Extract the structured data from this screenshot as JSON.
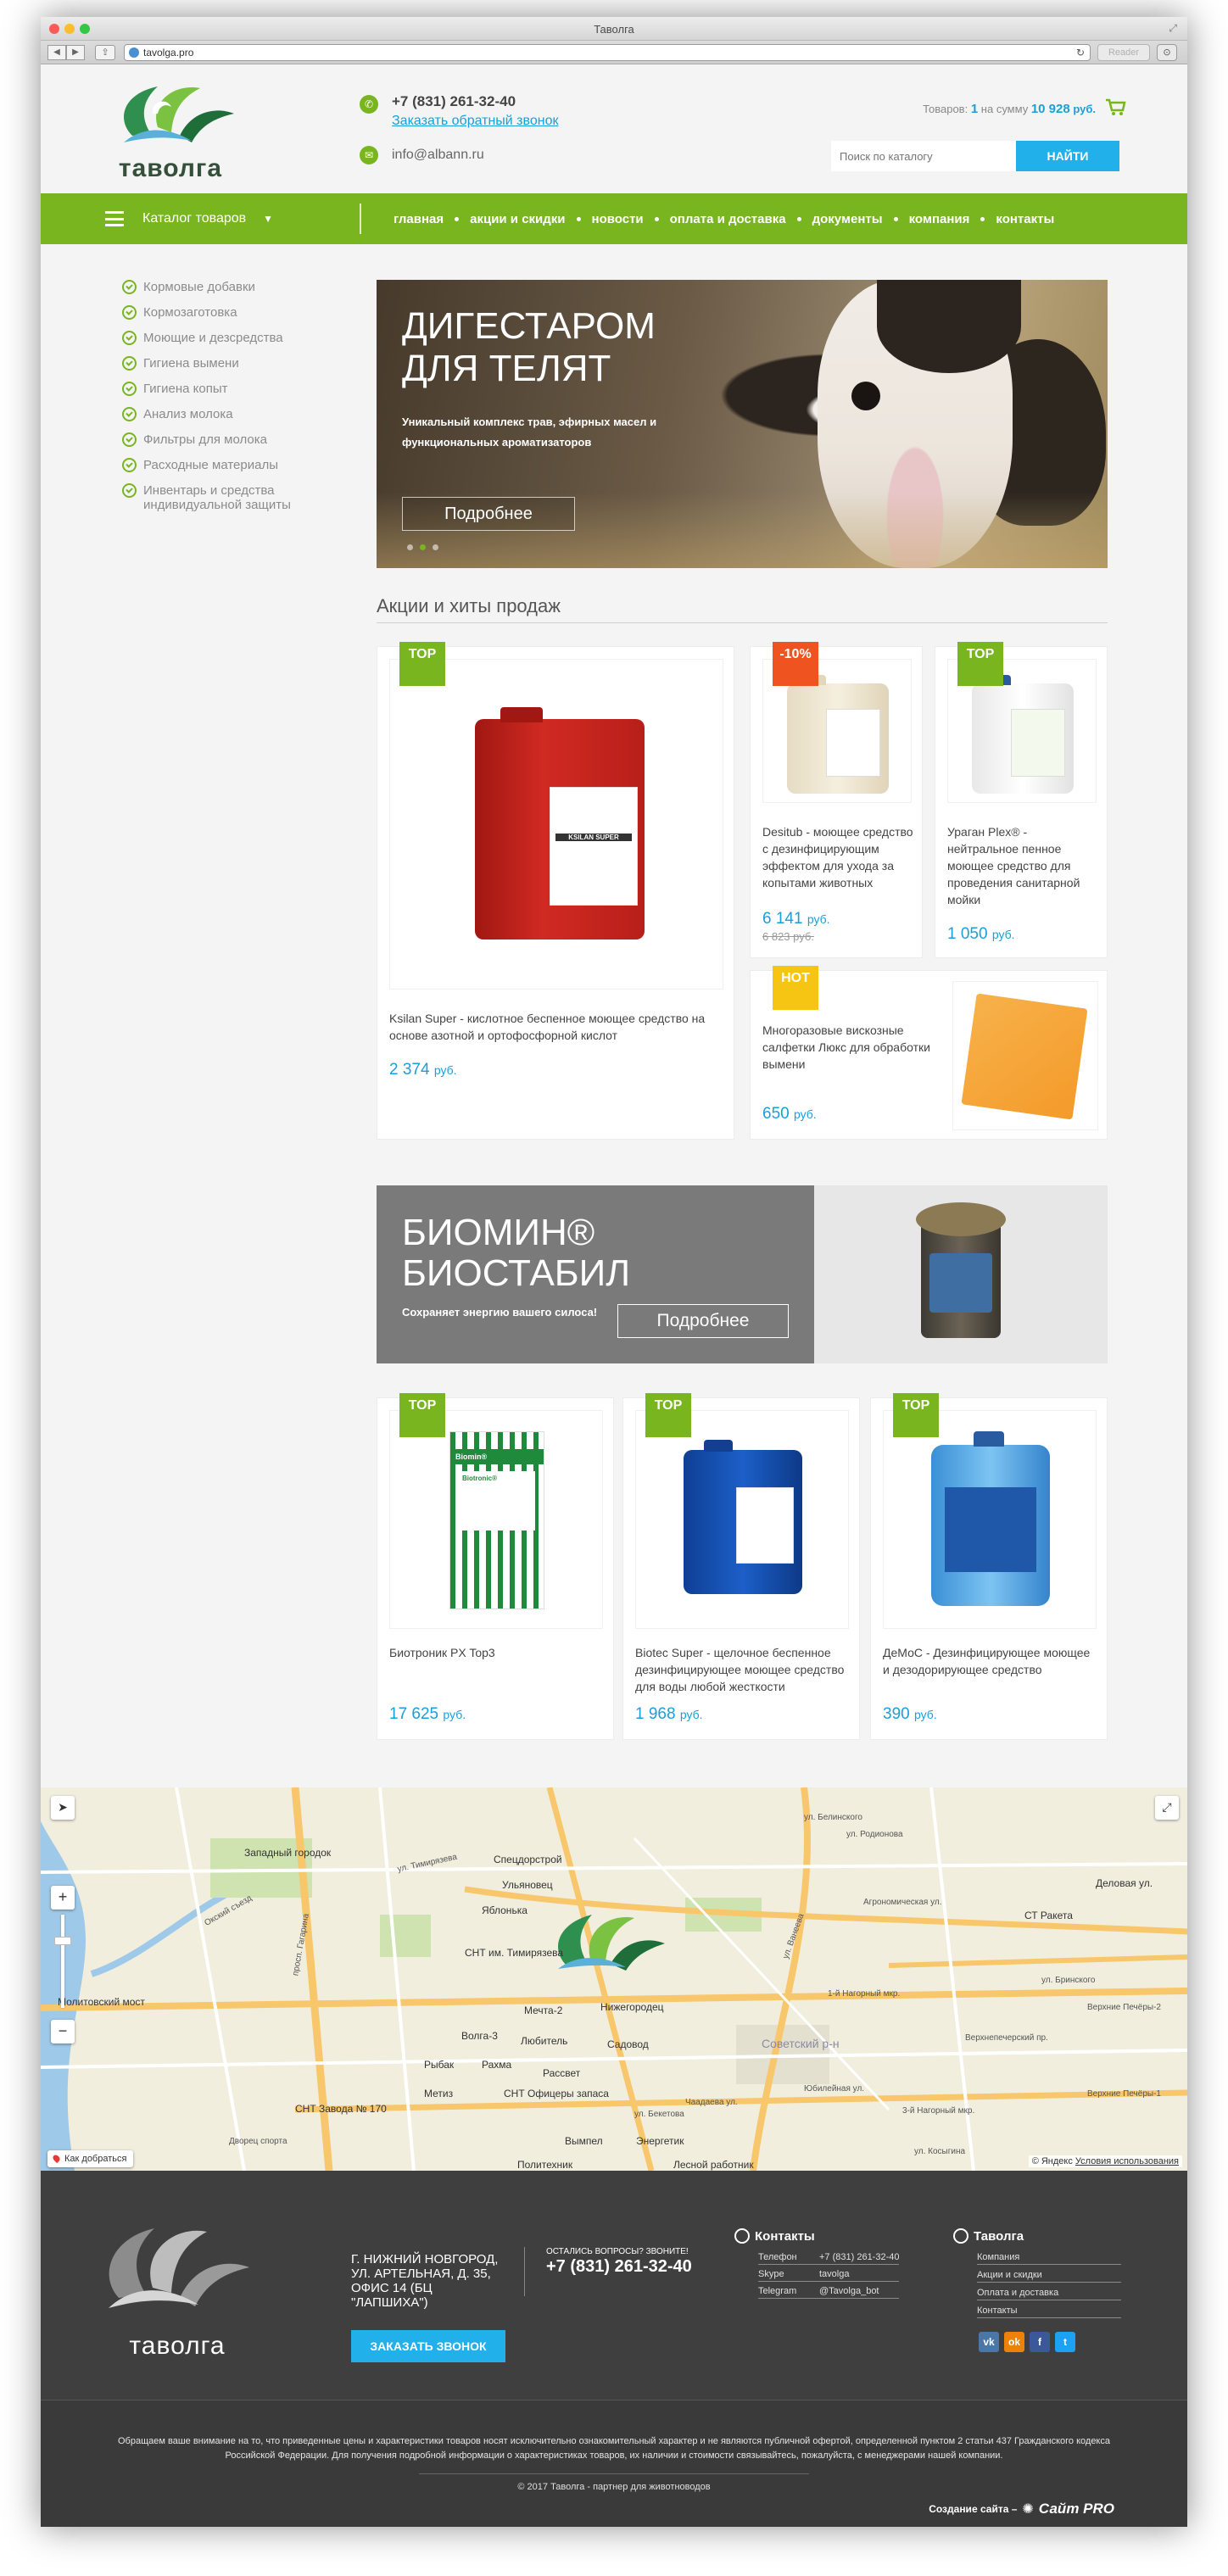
{
  "browser": {
    "window_title": "Таволга",
    "url": "tavolga.pro",
    "reader_label": "Reader"
  },
  "header": {
    "logo_text": "таволга",
    "phone": "+7 (831) 261-32-40",
    "callback_link": "Заказать обратный звонок",
    "email": "info@albann.ru",
    "cart_prefix": "Товаров:",
    "cart_count": "1",
    "cart_mid": "на сумму",
    "cart_sum": "10 928",
    "cart_currency": "руб.",
    "search_placeholder": "Поиск по каталогу",
    "search_button": "НАЙТИ"
  },
  "nav": {
    "catalog_label": "Каталог товаров",
    "items": [
      "главная",
      "акции и скидки",
      "новости",
      "оплата и доставка",
      "документы",
      "компания",
      "контакты"
    ]
  },
  "sidebar": {
    "items": [
      "Кормовые добавки",
      "Кормозаготовка",
      "Моющие и дезсредства",
      "Гигиена вымени",
      "Гигиена копыт",
      "Анализ молока",
      "Фильтры для молока",
      "Расходные материалы",
      "Инвентарь и средства индивидуальной защиты"
    ]
  },
  "hero": {
    "title": "ДИГЕСТАРОМ ДЛЯ ТЕЛЯТ",
    "subtitle": "Уникальный комплекс трав, эфирных масел и функциональных ароматизаторов",
    "button": "Подробнее"
  },
  "section_title": "Акции и хиты продаж",
  "currency": "руб.",
  "products": [
    {
      "tag": "TOP",
      "name": "Ksilan Super - кислотное беспенное моющее средство на основе азотной и ортофосфорной кислот",
      "price": "2 374"
    },
    {
      "tag": "-10%",
      "name": "Desitub - моющее средство с дезинфицирующим эффектом для ухода за копытами животных",
      "price": "6 141",
      "old_price": "6 823 руб."
    },
    {
      "tag": "TOP",
      "name": "Ураган Plex® - нейтральное пенное моющее средство для проведения санитарной мойки",
      "price": "1 050"
    },
    {
      "tag": "HOT",
      "name": "Многоразовые вискозные салфетки Люкс для обработки вымени",
      "price": "650"
    },
    {
      "tag": "TOP",
      "name": "Биотроник PX Top3",
      "price": "17 625"
    },
    {
      "tag": "TOP",
      "name": "Biotec Super - щелочное беспенное дезинфицирующее моющее средство для воды любой жесткости",
      "price": "1 968"
    },
    {
      "tag": "TOP",
      "name": "ДеМоС - Дезинфицирующее моющее и дезодорирующее средство",
      "price": "390"
    }
  ],
  "product_labels": {
    "ksilan": "KSILAN SUPER",
    "biomin": "Biomin®",
    "biotronic": "Biotronic®"
  },
  "promo": {
    "title_line1": "БИОМИН®",
    "title_line2": "БИОСТАБИЛ",
    "subtitle": "Сохраняет энергию вашего силоса!",
    "button": "Подробнее"
  },
  "map": {
    "labels": [
      "Западный городок",
      "Спецдорстрой",
      "Ульяновец",
      "Яблонька",
      "Окский съезд",
      "СНТ им. Тимирязева",
      "Мечта-2",
      "Нижегородец",
      "Любитель",
      "Садовод",
      "Волга-3",
      "Рыбак",
      "Рахма",
      "Рассвет",
      "Метиз",
      "СНТ Офицеры запаса",
      "СНТ Завода № 170",
      "Дворец спорта",
      "Вымпел",
      "Энергетик",
      "Политехник",
      "Лесной работник",
      "Деловая ул.",
      "СТ Ракета",
      "Верхние Печёры-2",
      "Верхние Печёры-1",
      "Советский р-н",
      "1-й Нагорный мкр.",
      "3-й Нагорный мкр.",
      "Молитовский мост",
      "просп. Гагарина",
      "ул. Ванеева",
      "ул. Бекетова",
      "ул. Тимирязева",
      "ул. Белинского",
      "ул. Бринского",
      "Агрономическая ул.",
      "ул. Косыгина",
      "Верхнепечерский пр.",
      "ул. Родионова",
      "Юбилейная ул.",
      "Чаадаева ул."
    ],
    "route_button": "Как добраться",
    "copyright": "© Яндекс",
    "terms": "Условия использования",
    "zoom_in": "+",
    "zoom_out": "−"
  },
  "footer": {
    "logo_text": "таволга",
    "address": "Г. НИЖНИЙ НОВГОРОД, УЛ. АРТЕЛЬНАЯ, Д. 35, ОФИС 14 (БЦ \"ЛАПШИХА\")",
    "ask": "ОСТАЛИСЬ ВОПРОСЫ? ЗВОНИТЕ!",
    "phone": "+7 (831) 261-32-40",
    "callback_button": "ЗАКАЗАТЬ ЗВОНОК",
    "contacts_title": "Контакты",
    "contacts": [
      {
        "key": "Телефон",
        "value": "+7 (831) 261-32-40"
      },
      {
        "key": "Skype",
        "value": "tavolga"
      },
      {
        "key": "Telegram",
        "value": "@Tavolga_bot"
      }
    ],
    "company_title": "Таволга",
    "company_links": [
      "Компания",
      "Акции и скидки",
      "Оплата и доставка",
      "Контакты"
    ],
    "socials": [
      {
        "label": "vk",
        "color": "#4a76a8"
      },
      {
        "label": "ok",
        "color": "#ee8208"
      },
      {
        "label": "f",
        "color": "#3b5998"
      },
      {
        "label": "t",
        "color": "#1da1f2"
      }
    ],
    "legal": "Обращаем ваше внимание на то, что приведенные цены и характеристики товаров носят исключительно ознакомительный характер и не являются публичной офертой, определенной пунктом 2 статьи 437 Гражданского кодекса Российской Федерации. Для получения подробной информации о характеристиках товаров, их наличии и стоимости связывайтесь, пожалуйста, с менеджерами нашей компании.",
    "copyright": "© 2017 Таволга - партнер для животноводов",
    "made_by_prefix": "Создание сайта –",
    "made_by_brand": "Сайт PRO"
  },
  "colors": {
    "green": "#79b51e",
    "blue": "#22b0ea",
    "price_blue": "#1a9fd8",
    "discount": "#ef5320",
    "hot": "#f6c413"
  }
}
